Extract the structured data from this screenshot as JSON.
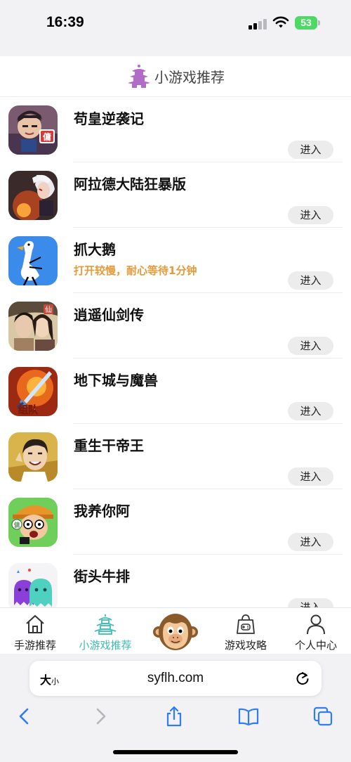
{
  "status_bar": {
    "time": "16:39",
    "battery": "53",
    "icons": [
      "signal-icon",
      "wifi-icon",
      "battery-icon"
    ]
  },
  "header": {
    "title": "小游戏推荐",
    "logo_icon": "pagoda-icon"
  },
  "games": [
    {
      "name": "苟皇逆袭记",
      "note": "",
      "button": "进入",
      "icon": "game-icon-warrior"
    },
    {
      "name": "阿拉德大陆狂暴版",
      "note": "",
      "button": "进入",
      "icon": "game-icon-demon"
    },
    {
      "name": "抓大鹅",
      "note": "打开较慢，耐心等待1分钟",
      "button": "进入",
      "icon": "game-icon-goose"
    },
    {
      "name": "逍遥仙剑传",
      "note": "",
      "button": "进入",
      "icon": "game-icon-immortals"
    },
    {
      "name": "地下城与魔兽",
      "note": "",
      "button": "进入",
      "icon": "game-icon-sword"
    },
    {
      "name": "重生干帝王",
      "note": "",
      "button": "进入",
      "icon": "game-icon-emperor"
    },
    {
      "name": "我养你阿",
      "note": "",
      "button": "进入",
      "icon": "game-icon-cartoon-man"
    },
    {
      "name": "街头牛排",
      "note": "",
      "button": "进入",
      "icon": "game-icon-ghosts"
    }
  ],
  "icon_badges": {
    "warrior": "傭",
    "immortals": "仙",
    "sword": "组队",
    "cartoon": "傭"
  },
  "tab_bar": {
    "tabs": [
      {
        "label": "手游推荐",
        "icon": "home-icon"
      },
      {
        "label": "小游戏推荐",
        "icon": "pagoda-icon"
      },
      {
        "label": "",
        "icon": "monkey-logo-icon"
      },
      {
        "label": "游戏攻略",
        "icon": "gamepad-bag-icon"
      },
      {
        "label": "个人中心",
        "icon": "person-icon"
      }
    ],
    "active_index": 1
  },
  "browser": {
    "text_size_big": "大",
    "text_size_small": "小",
    "url": "syflh.com",
    "nav_icons": [
      "back-icon",
      "forward-icon",
      "share-icon",
      "bookmarks-icon",
      "tabs-icon"
    ]
  },
  "colors": {
    "accent": "#3dbdb0",
    "note": "#e69a3a",
    "logo_purple": "#b06cc8",
    "battery_green": "#4cd964",
    "link_blue": "#2f7cf6"
  }
}
